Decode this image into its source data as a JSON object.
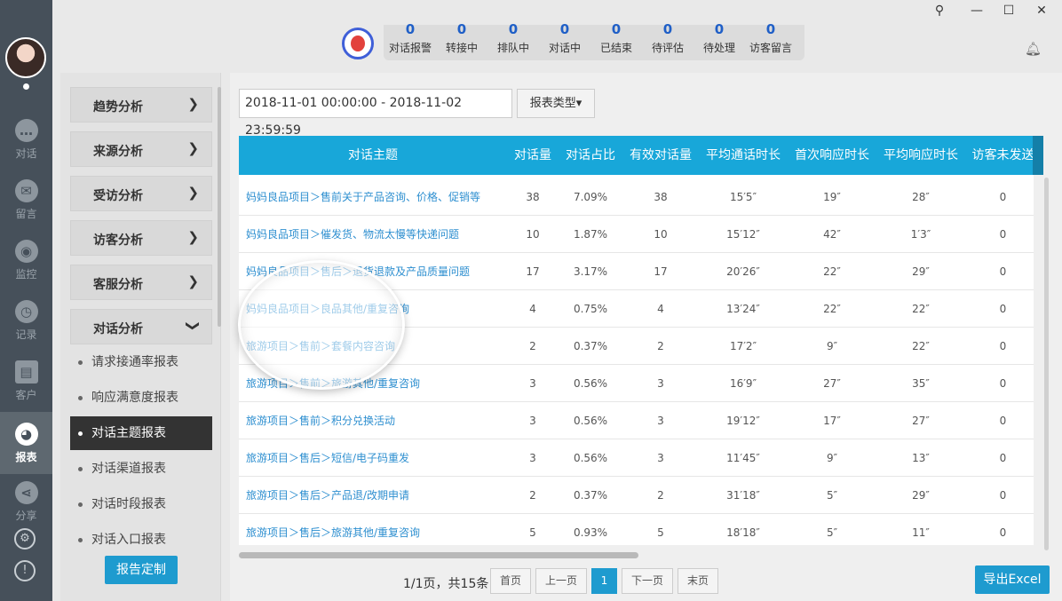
{
  "rail": {
    "items": [
      {
        "label": "对话",
        "icon": "chat-icon"
      },
      {
        "label": "留言",
        "icon": "mail-icon"
      },
      {
        "label": "监控",
        "icon": "eye-icon"
      },
      {
        "label": "记录",
        "icon": "clock-icon"
      },
      {
        "label": "客户",
        "icon": "contact-card-icon"
      },
      {
        "label": "报表",
        "icon": "pie-chart-icon"
      },
      {
        "label": "分享",
        "icon": "share-icon"
      }
    ],
    "active": "报表"
  },
  "stats": [
    {
      "value": "0",
      "label": "对话报警"
    },
    {
      "value": "0",
      "label": "转接中"
    },
    {
      "value": "0",
      "label": "排队中"
    },
    {
      "value": "0",
      "label": "对话中"
    },
    {
      "value": "0",
      "label": "已结束"
    },
    {
      "value": "0",
      "label": "待评估"
    },
    {
      "value": "0",
      "label": "待处理"
    },
    {
      "value": "0",
      "label": "访客留言"
    }
  ],
  "menu": {
    "sections": [
      "趋势分析",
      "来源分析",
      "受访分析",
      "访客分析",
      "客服分析",
      "对话分析"
    ],
    "subitems": [
      "请求接通率报表",
      "响应满意度报表",
      "对话主题报表",
      "对话渠道报表",
      "对话时段报表",
      "对话入口报表"
    ],
    "active_sub": "对话主题报表",
    "custom_button": "报告定制"
  },
  "filters": {
    "date_range": "2018-11-01 00:00:00  - 2018-11-02 23:59:59",
    "report_type": "报表类型▾"
  },
  "table": {
    "headers": [
      "对话主题",
      "对话量",
      "对话占比",
      "有效对话量",
      "平均通话时长",
      "首次响应时长",
      "平均响应时长",
      "访客未发送"
    ],
    "rows": [
      {
        "topic": "妈妈良品项目＞售前关于产品咨询、价格、促销等",
        "count": "38",
        "ratio": "7.09%",
        "valid": "38",
        "avg_talk": "15′5″",
        "first_resp": "19″",
        "avg_resp": "28″",
        "unsent": "0"
      },
      {
        "topic": "妈妈良品项目＞催发货、物流太慢等快递问题",
        "count": "10",
        "ratio": "1.87%",
        "valid": "10",
        "avg_talk": "15′12″",
        "first_resp": "42″",
        "avg_resp": "1′3″",
        "unsent": "0"
      },
      {
        "topic": "妈妈良品项目＞售后＞退货退款及产品质量问题",
        "count": "17",
        "ratio": "3.17%",
        "valid": "17",
        "avg_talk": "20′26″",
        "first_resp": "22″",
        "avg_resp": "29″",
        "unsent": "0"
      },
      {
        "topic": "妈妈良品项目＞良品其他/重复咨询",
        "count": "4",
        "ratio": "0.75%",
        "valid": "4",
        "avg_talk": "13′24″",
        "first_resp": "22″",
        "avg_resp": "22″",
        "unsent": "0"
      },
      {
        "topic": "旅游项目＞售前＞套餐内容咨询",
        "count": "2",
        "ratio": "0.37%",
        "valid": "2",
        "avg_talk": "17′2″",
        "first_resp": "9″",
        "avg_resp": "22″",
        "unsent": "0"
      },
      {
        "topic": "旅游项目＞售前＞旅游其他/重复咨询",
        "count": "3",
        "ratio": "0.56%",
        "valid": "3",
        "avg_talk": "16′9″",
        "first_resp": "27″",
        "avg_resp": "35″",
        "unsent": "0"
      },
      {
        "topic": "旅游项目＞售前＞积分兑换活动",
        "count": "3",
        "ratio": "0.56%",
        "valid": "3",
        "avg_talk": "19′12″",
        "first_resp": "17″",
        "avg_resp": "27″",
        "unsent": "0"
      },
      {
        "topic": "旅游项目＞售后＞短信/电子码重发",
        "count": "3",
        "ratio": "0.56%",
        "valid": "3",
        "avg_talk": "11′45″",
        "first_resp": "9″",
        "avg_resp": "13″",
        "unsent": "0"
      },
      {
        "topic": "旅游项目＞售后＞产品退/改期申请",
        "count": "2",
        "ratio": "0.37%",
        "valid": "2",
        "avg_talk": "31′18″",
        "first_resp": "5″",
        "avg_resp": "29″",
        "unsent": "0"
      },
      {
        "topic": "旅游项目＞售后＞旅游其他/重复咨询",
        "count": "5",
        "ratio": "0.93%",
        "valid": "5",
        "avg_talk": "18′18″",
        "first_resp": "5″",
        "avg_resp": "11″",
        "unsent": "0"
      }
    ]
  },
  "pagination": {
    "info": "1/1页，共15条",
    "first": "首页",
    "prev": "上一页",
    "current": "1",
    "next": "下一页",
    "last": "末页"
  },
  "export_button": "导出Excel",
  "window": {
    "pin": "⚲",
    "minimize": "—",
    "maximize": "☐",
    "close": "✕"
  },
  "colors": {
    "accent": "#18a7d9",
    "rail": "#46505a",
    "link": "#2e8fd0",
    "stat_number": "#1f5fc7"
  }
}
